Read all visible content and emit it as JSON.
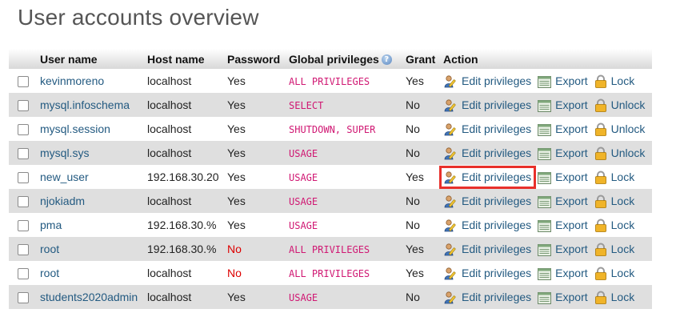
{
  "page": {
    "title": "User accounts overview"
  },
  "table": {
    "headers": {
      "user": "User name",
      "host": "Host name",
      "password": "Password",
      "privileges": "Global privileges",
      "grant": "Grant",
      "action": "Action"
    },
    "actions": {
      "edit": "Edit privileges",
      "export": "Export"
    },
    "rows": [
      {
        "user": "kevinmoreno",
        "host": "localhost",
        "password": "Yes",
        "privileges": "ALL PRIVILEGES",
        "grant": "Yes",
        "lock": "Lock"
      },
      {
        "user": "mysql.infoschema",
        "host": "localhost",
        "password": "Yes",
        "privileges": "SELECT",
        "grant": "No",
        "lock": "Unlock"
      },
      {
        "user": "mysql.session",
        "host": "localhost",
        "password": "Yes",
        "privileges": "SHUTDOWN, SUPER",
        "grant": "No",
        "lock": "Unlock"
      },
      {
        "user": "mysql.sys",
        "host": "localhost",
        "password": "Yes",
        "privileges": "USAGE",
        "grant": "No",
        "lock": "Unlock"
      },
      {
        "user": "new_user",
        "host": "192.168.30.20",
        "password": "Yes",
        "privileges": "USAGE",
        "grant": "Yes",
        "lock": "Lock"
      },
      {
        "user": "njokiadm",
        "host": "localhost",
        "password": "Yes",
        "privileges": "USAGE",
        "grant": "No",
        "lock": "Lock"
      },
      {
        "user": "pma",
        "host": "192.168.30.%",
        "password": "Yes",
        "privileges": "USAGE",
        "grant": "No",
        "lock": "Lock"
      },
      {
        "user": "root",
        "host": "192.168.30.%",
        "password": "No",
        "privileges": "ALL PRIVILEGES",
        "grant": "Yes",
        "lock": "Lock"
      },
      {
        "user": "root",
        "host": "localhost",
        "password": "No",
        "privileges": "ALL PRIVILEGES",
        "grant": "Yes",
        "lock": "Lock"
      },
      {
        "user": "students2020admin",
        "host": "localhost",
        "password": "Yes",
        "privileges": "USAGE",
        "grant": "No",
        "lock": "Lock"
      }
    ]
  },
  "colors": {
    "link": "#235a81",
    "privilege_text": "#d01873",
    "password_no": "#dd0000",
    "row_alt": "#dfdfdf",
    "highlight": "#e8302b"
  },
  "icons": {
    "edit": "edit-privileges-icon",
    "export": "export-icon",
    "lock": "lock-icon",
    "help": "help-icon"
  }
}
